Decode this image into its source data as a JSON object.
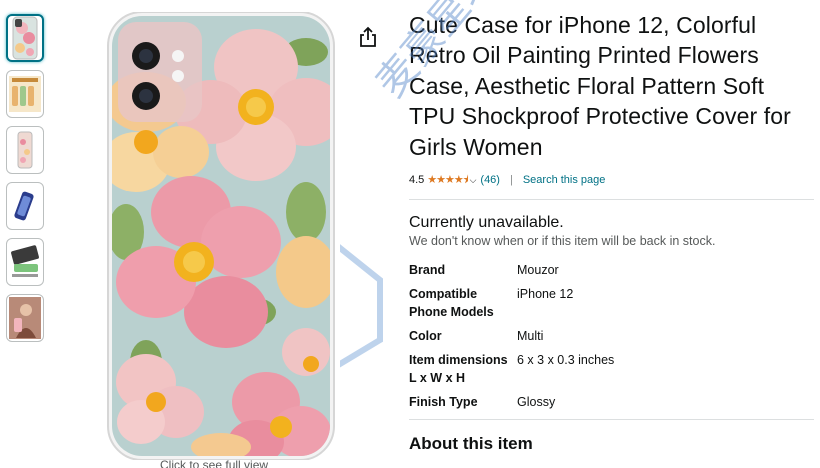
{
  "product": {
    "title": "Cute Case for iPhone 12, Colorful Retro Oil Painting Printed Flowers Case, Aesthetic Floral Pattern Soft TPU Shockproof Protective Cover for Girls Women"
  },
  "rating": {
    "value": "4.5",
    "stars": 4.5,
    "count": "(46)",
    "separator": "|",
    "search_link": "Search this page"
  },
  "availability": {
    "status": "Currently unavailable.",
    "note": "We don't know when or if this item will be back in stock."
  },
  "specs": [
    {
      "key": "Brand",
      "value": "Mouzor"
    },
    {
      "key": "Compatible Phone Models",
      "value": "iPhone 12"
    },
    {
      "key": "Color",
      "value": "Multi"
    },
    {
      "key": "Item dimensions L x W x H",
      "value": "6 x 3 x 0.3 inches"
    },
    {
      "key": "Finish Type",
      "value": "Glossy"
    }
  ],
  "about_heading": "About this item",
  "image_caption": "Click to see full view",
  "watermark": "麦豪星球",
  "icons": {
    "share": "share-icon",
    "chevron": "chevron-down-icon"
  },
  "colors": {
    "link": "#007185",
    "star": "#de7921",
    "text": "#0f1111",
    "muted": "#565959"
  }
}
